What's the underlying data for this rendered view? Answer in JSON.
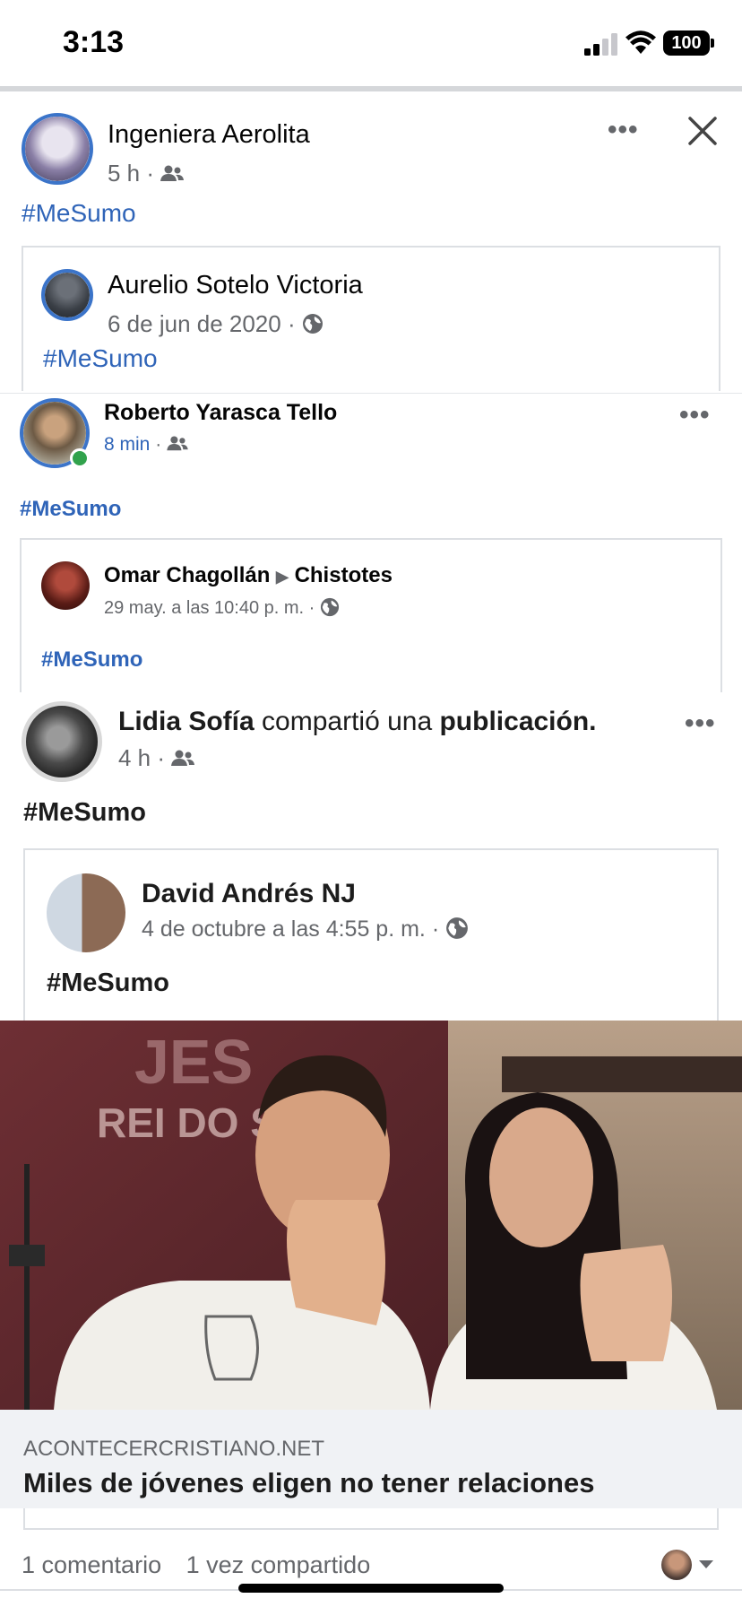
{
  "status_bar": {
    "time": "3:13",
    "battery": "100"
  },
  "post1": {
    "author": "Ingeniera Aerolita",
    "time": "5 h",
    "sep": "·",
    "hashtag": "#MeSumo",
    "more": "•••",
    "shared": {
      "author": "Aurelio Sotelo Victoria",
      "date": "6 de jun de 2020",
      "sep": "·",
      "hashtag": "#MeSumo"
    }
  },
  "post2": {
    "author": "Roberto Yarasca Tello",
    "time": "8 min",
    "sep": "·",
    "hashtag": "#MeSumo",
    "more": "•••",
    "shared": {
      "author": "Omar Chagollán",
      "arrow": "▶",
      "group": "Chistotes",
      "date": "29 may. a las 10:40 p. m.",
      "sep": "·",
      "hashtag": "#MeSumo"
    }
  },
  "post3": {
    "author": "Lidia Sofía",
    "action_text": "compartió una",
    "action_object": "publicación.",
    "time": "4 h",
    "sep": "·",
    "hashtag": "#MeSumo",
    "more": "•••",
    "shared": {
      "author": "David Andrés NJ",
      "date": "4 de octubre a las 4:55 p. m.",
      "sep": "·",
      "hashtag": "#MeSumo"
    },
    "photo_sign_line1": "JES",
    "photo_sign_line2": "REI DO  S",
    "link": {
      "domain": "ACONTECERCRISTIANO.NET",
      "title": "Miles de jóvenes eligen no tener relaciones"
    },
    "comments": "1 comentario",
    "shares": "1 vez compartido"
  },
  "icons": {
    "signal": "signal-icon",
    "wifi": "wifi-icon",
    "battery": "battery-icon",
    "friends": "friends-icon",
    "globe": "globe-icon",
    "close": "close-icon",
    "more": "more-icon"
  },
  "colors": {
    "hashtag_blue": "#2f64b8",
    "meta_gray": "#65676b",
    "avatar_ring": "#3b74c9",
    "online_green": "#31a24c"
  }
}
